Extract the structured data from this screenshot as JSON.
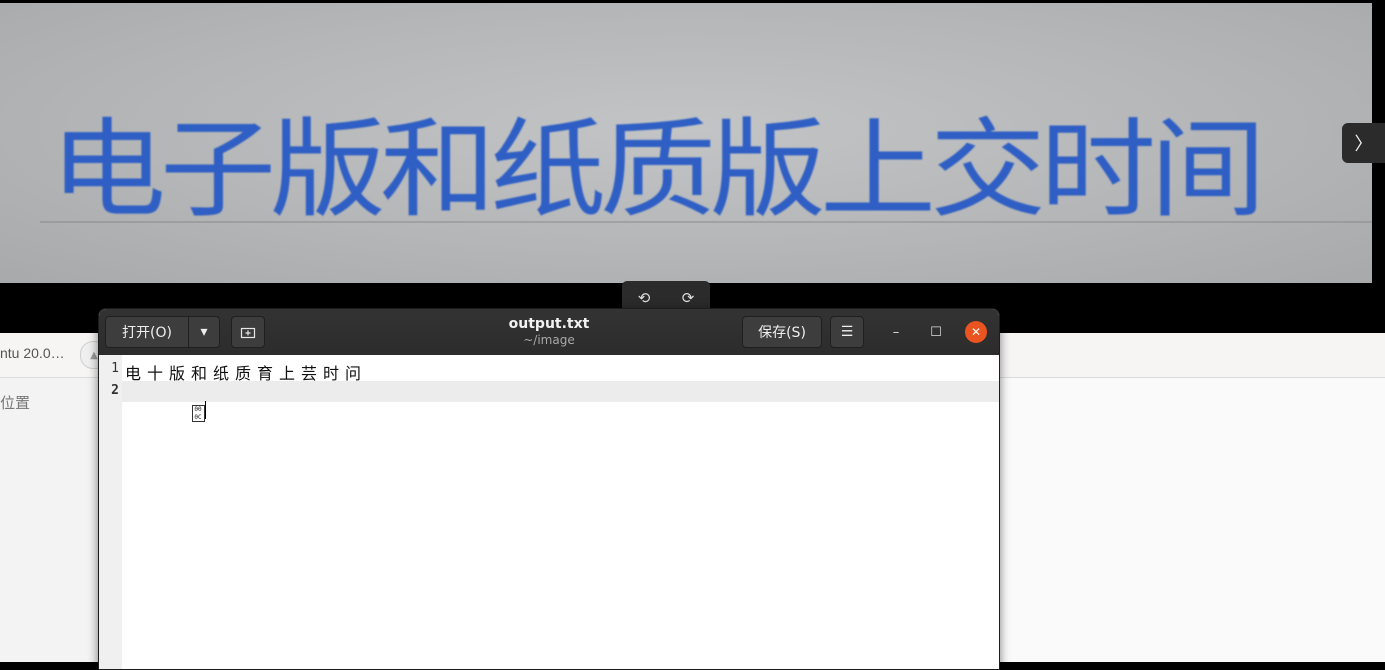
{
  "viewer": {
    "photo_text": "电子版和纸质版上交时间",
    "next_icon": "chevron-right-icon",
    "rotate_left_icon": "rotate-left-icon",
    "rotate_right_icon": "rotate-right-icon"
  },
  "files": {
    "breadcrumb": "ntu 20.0…",
    "sidebar_other": "位置"
  },
  "editor": {
    "open_label": "打开(O)",
    "save_label": "保存(S)",
    "title": "output.txt",
    "path": "~/image",
    "lines": [
      {
        "number": "1",
        "text": "电十版和纸质育上芸时问"
      },
      {
        "number": "2",
        "text": "",
        "special_char": "000C"
      }
    ],
    "close_color": "#e95420"
  }
}
